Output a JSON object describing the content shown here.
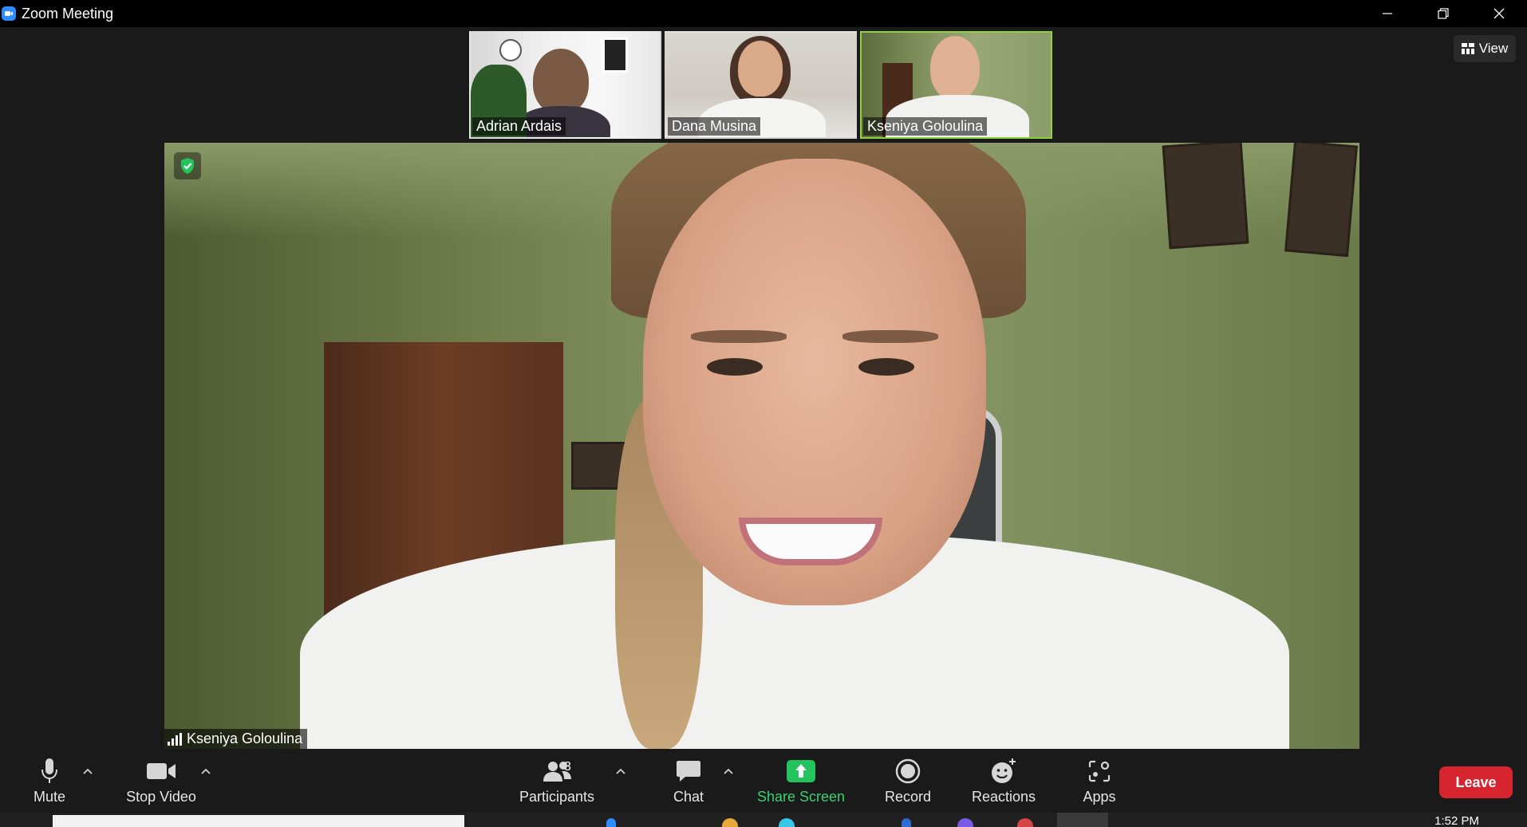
{
  "window": {
    "title": "Zoom Meeting",
    "controls": [
      "minimize-icon",
      "restore-icon",
      "close-icon"
    ]
  },
  "view_button": {
    "label": "View",
    "icon": "grid-icon"
  },
  "thumbnails": [
    {
      "name": "Adrian Ardais",
      "active": false
    },
    {
      "name": "Dana Musina",
      "active": false
    },
    {
      "name": "Kseniya Goloulina",
      "active": true
    }
  ],
  "main_video": {
    "participant_name": "Kseniya Goloulina",
    "encryption_icon": "shield-check-icon"
  },
  "toolbar": {
    "mute_label": "Mute",
    "stop_video_label": "Stop Video",
    "participants_label": "Participants",
    "participants_count": "3",
    "chat_label": "Chat",
    "share_screen_label": "Share Screen",
    "record_label": "Record",
    "reactions_label": "Reactions",
    "apps_label": "Apps",
    "leave_label": "Leave"
  },
  "colors": {
    "active_border": "#8fd13f",
    "share_green": "#3ad16f",
    "leave_red": "#d6252f",
    "zoom_blue": "#2d8cff"
  },
  "taskbar": {
    "time": "1:52 PM"
  }
}
